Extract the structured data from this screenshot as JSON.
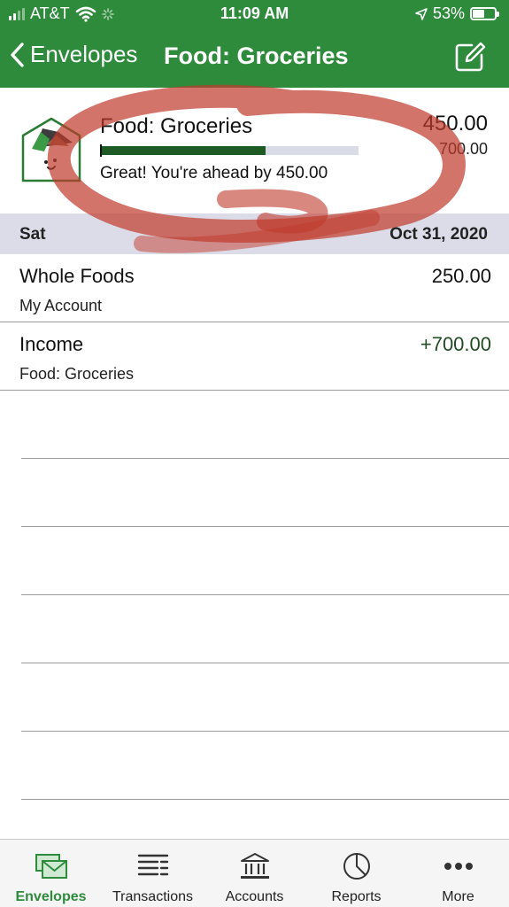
{
  "status_bar": {
    "carrier": "AT&T",
    "time": "11:09 AM",
    "battery": "53%",
    "battery_level": 0.53
  },
  "nav": {
    "back_label": "Envelopes",
    "title": "Food: Groceries",
    "edit_icon": "edit-icon"
  },
  "envelope": {
    "name": "Food: Groceries",
    "amount": "450.00",
    "budget": "700.00",
    "progress": 0.64,
    "message": "Great! You're ahead by 450.00"
  },
  "section": {
    "day": "Sat",
    "date": "Oct 31, 2020"
  },
  "transactions": [
    {
      "payee": "Whole Foods",
      "amount": "250.00",
      "account": "My Account"
    },
    {
      "payee": "Income",
      "amount": "+700.00",
      "account": "Food: Groceries"
    }
  ],
  "tabs": [
    {
      "label": "Envelopes",
      "icon": "envelopes-icon",
      "active": true
    },
    {
      "label": "Transactions",
      "icon": "transactions-list-icon",
      "active": false
    },
    {
      "label": "Accounts",
      "icon": "bank-icon",
      "active": false
    },
    {
      "label": "Reports",
      "icon": "pie-chart-icon",
      "active": false
    },
    {
      "label": "More",
      "icon": "more-dots-icon",
      "active": false
    }
  ],
  "colors": {
    "brand_green": "#2f8b3c",
    "progress_fill": "#1e5b24",
    "section_bg": "#dcdce8",
    "scribble": "#c0392b"
  }
}
